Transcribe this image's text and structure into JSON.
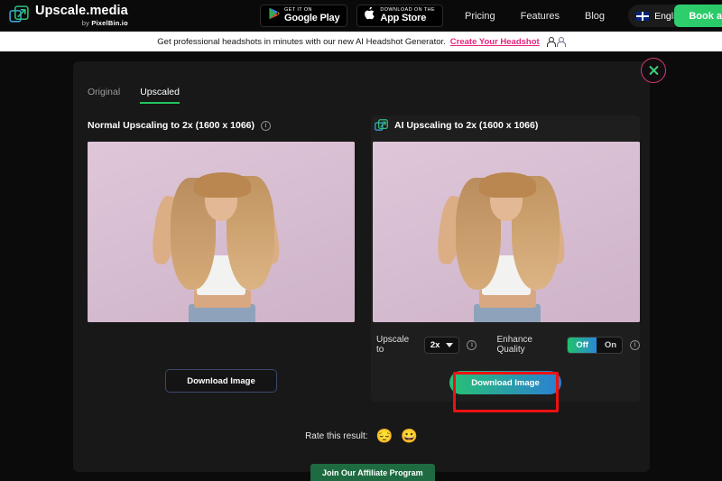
{
  "nav": {
    "brand_title": "Upscale.media",
    "brand_sub_prefix": "by ",
    "brand_sub_name": "PixelBin.io",
    "google_play": {
      "small": "GET IT ON",
      "big": "Google Play"
    },
    "app_store": {
      "small": "Download on the",
      "big": "App Store"
    },
    "links": [
      {
        "label": "Pricing"
      },
      {
        "label": "Features"
      },
      {
        "label": "Blog"
      }
    ],
    "language": "English",
    "book_label": "Book a"
  },
  "banner": {
    "text": "Get professional headshots in minutes with our new AI Headshot Generator.",
    "link": "Create Your Headshot"
  },
  "modal": {
    "tabs": [
      {
        "label": "Original",
        "active": false
      },
      {
        "label": "Upscaled",
        "active": true
      }
    ],
    "left": {
      "title": "Normal Upscaling to 2x (1600 x 1066)",
      "download_label": "Download Image"
    },
    "right": {
      "title": "AI Upscaling to 2x (1600 x 1066)",
      "upscale_label": "Upscale to",
      "upscale_value": "2x",
      "enhance_label": "Enhance Quality",
      "toggle_off": "Off",
      "toggle_on": "On",
      "toggle_selected": "Off",
      "download_label": "Download Image"
    },
    "rate_label": "Rate this result:",
    "rate_emoji_sad": "😔",
    "rate_emoji_happy": "😀"
  },
  "footer": {
    "affiliate_label": "Join Our Affiliate Program"
  },
  "colors": {
    "accent_green": "#22c55e",
    "accent_blue": "#2b7fd4",
    "banner_link_pink": "#e8257f",
    "highlight_red": "#ee1111",
    "close_border": "#d93b6e"
  }
}
